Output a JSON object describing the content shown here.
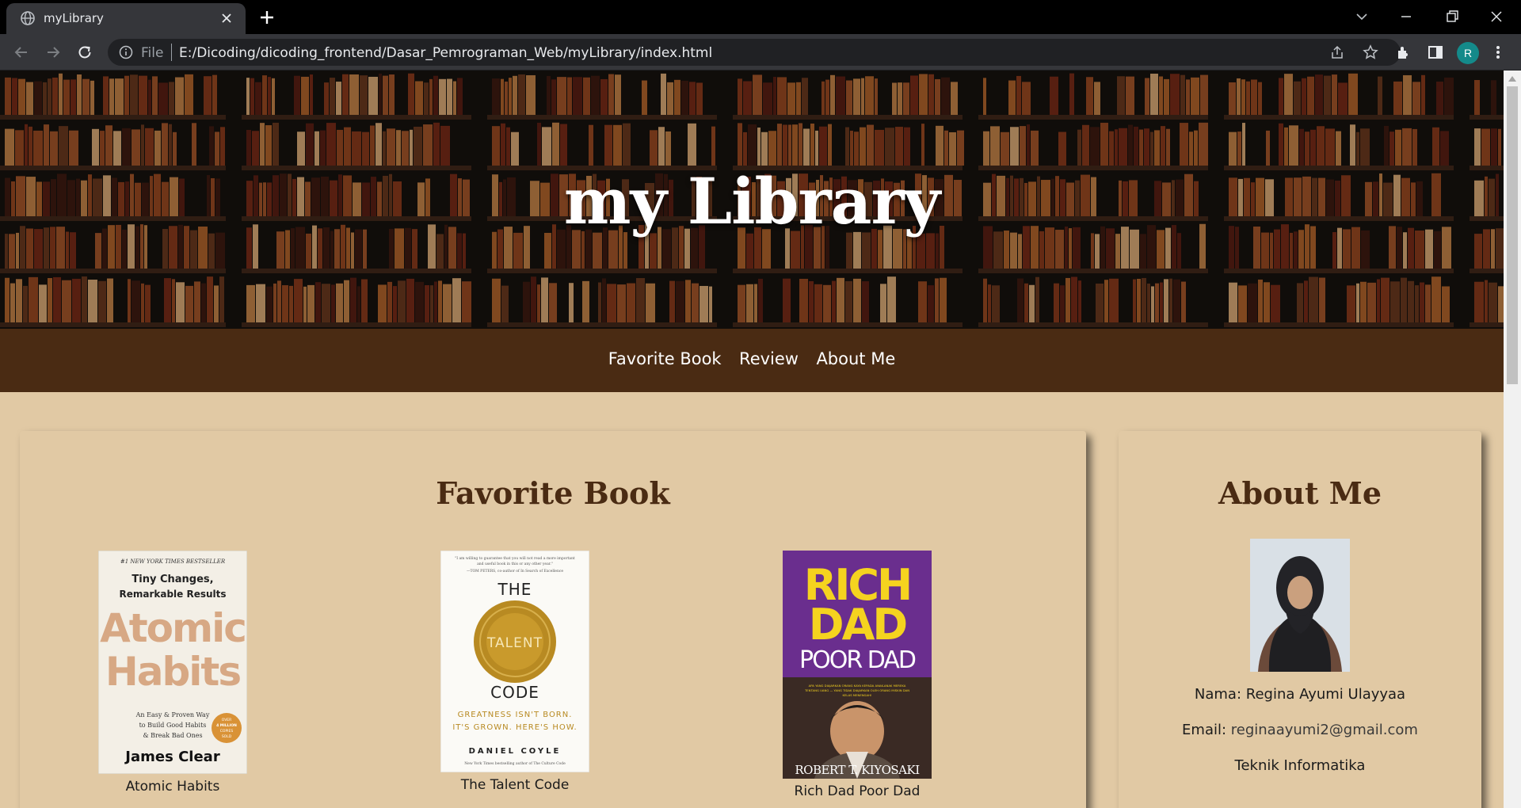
{
  "browser": {
    "tab_title": "myLibrary",
    "scheme_label": "File",
    "url": "E:/Dicoding/dicoding_frontend/Dasar_Pemrograman_Web/myLibrary/index.html",
    "profile_initial": "R"
  },
  "hero": {
    "title": "my Library"
  },
  "nav": {
    "items": [
      "Favorite Book",
      "Review",
      "About Me"
    ]
  },
  "favorite": {
    "heading": "Favorite Book",
    "books": [
      {
        "title": "Atomic Habits",
        "cover_text": {
          "tagline": "#1 NEW YORK TIMES BESTSELLER",
          "line1": "Tiny Changes,",
          "line2": "Remarkable Results",
          "title1": "Atomic",
          "title2": "Habits",
          "sub1": "An Easy & Proven Way",
          "sub2": "to Build Good Habits",
          "sub3": "& Break Bad Ones",
          "badge1": "OVER",
          "badge2": "4 MILLION",
          "badge3": "COPIES",
          "badge4": "SOLD",
          "author": "James Clear"
        }
      },
      {
        "title": "The Talent Code",
        "cover_text": {
          "quote1": "\"I am willing to guarantee that you will not read a more important",
          "quote2": "and useful book in this or any other year.\"",
          "quote3": "—TOM PETERS, co-author of In Search of Excellence",
          "the": "THE",
          "seal": "TALENT",
          "code": "CODE",
          "sub1": "GREATNESS ISN'T BORN.",
          "sub2": "IT'S GROWN. HERE'S HOW.",
          "author": "DANIEL COYLE",
          "foot": "New York Times bestselling author of The Culture Code"
        }
      },
      {
        "title": "Rich Dad Poor Dad",
        "cover_text": {
          "rich": "RICH",
          "dad": "DAD",
          "poordad": "POOR DAD",
          "sub1": "APA YANG DIAJARKAN ORANG KAYA KEPADA ANAK-ANAK MEREKA",
          "sub2": "TENTANG UANG — YANG TIDAK DIAJARKAN OLEH ORANG MISKIN DAN",
          "sub3": "KELAS MENENGAH!",
          "author": "ROBERT T. KIYOSAKI"
        }
      }
    ]
  },
  "about": {
    "heading": "About Me",
    "name_line": "Nama: Regina Ayumi Ulayyaa",
    "email_label": "Email: ",
    "email": "reginaayumi2@gmail.com",
    "major": "Teknik Informatika"
  },
  "colors": {
    "page_bg": "#e1c9a4",
    "nav_bg": "#4a2b13",
    "heading": "#4a2b13"
  }
}
